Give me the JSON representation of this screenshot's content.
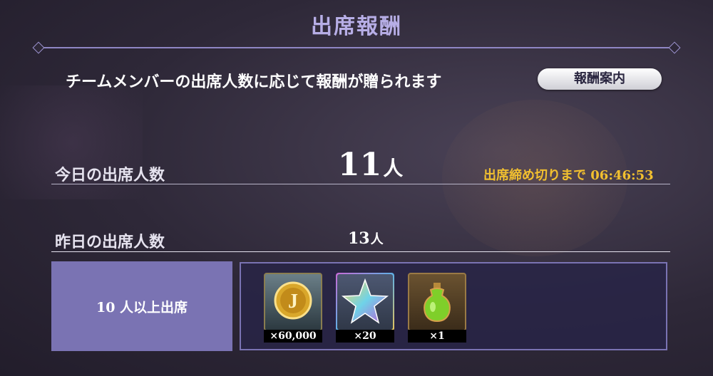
{
  "header": {
    "title": "出席報酬"
  },
  "info": {
    "description": "チームメンバーの出席人数に応じて報酬が贈られます",
    "guide_button": "報酬案内"
  },
  "today": {
    "label": "今日の出席人数",
    "count": "11",
    "unit": "人",
    "deadline": "出席締め切りまで 06:46:53"
  },
  "yesterday": {
    "label": "昨日の出席人数",
    "count": "13",
    "unit": "人"
  },
  "tier": {
    "label": "10 人以上出席"
  },
  "rewards": [
    {
      "icon": "gold-coin-icon",
      "quantity": "×60,000"
    },
    {
      "icon": "rainbow-star-icon",
      "quantity": "×20"
    },
    {
      "icon": "green-potion-icon",
      "quantity": "×1"
    }
  ],
  "colors": {
    "accent": "#7a73b3",
    "title": "#b7aee6",
    "deadline": "#f2c02f"
  }
}
